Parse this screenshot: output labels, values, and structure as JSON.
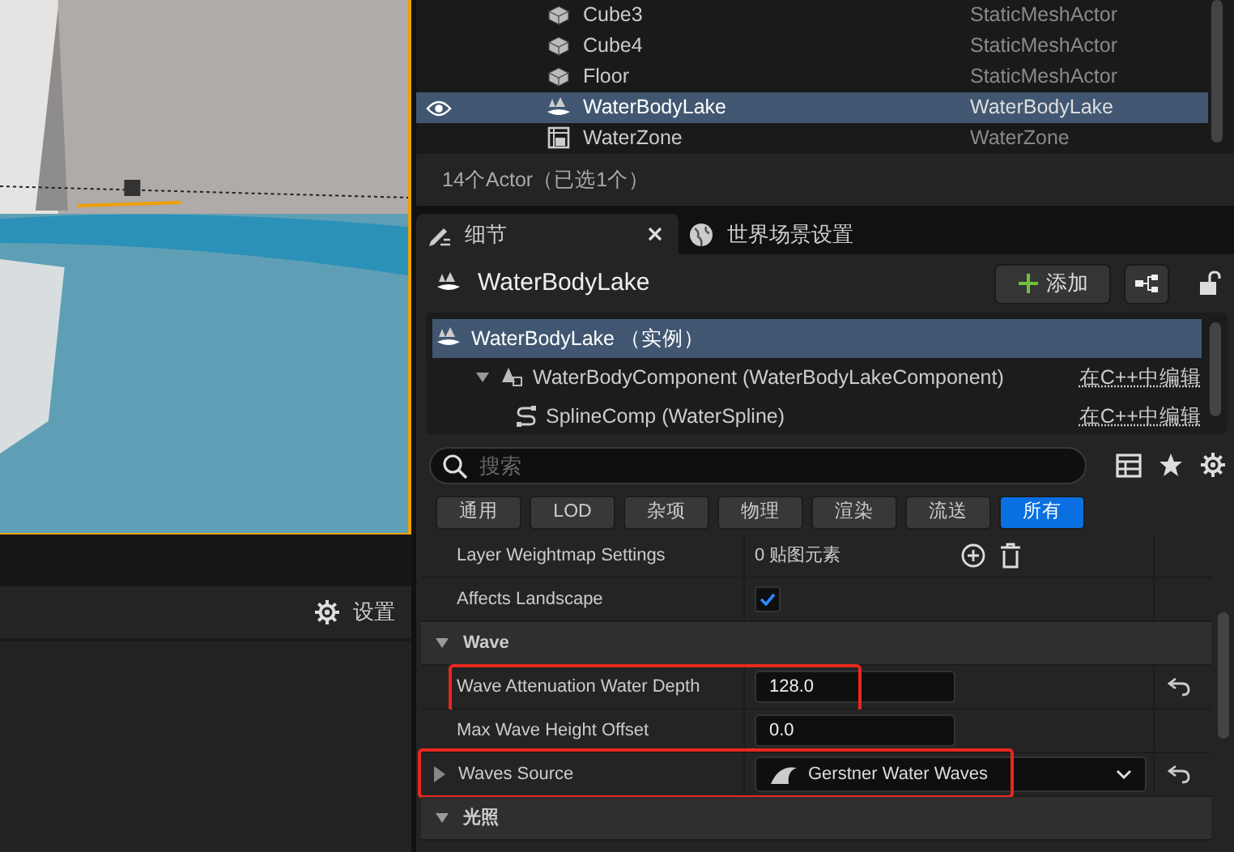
{
  "viewport": {
    "settings_label": "设置"
  },
  "outliner": {
    "rows": [
      {
        "label": "Cube3",
        "type": "StaticMeshActor",
        "kind": "mesh",
        "selected": false,
        "visible": false
      },
      {
        "label": "Cube4",
        "type": "StaticMeshActor",
        "kind": "mesh",
        "selected": false,
        "visible": false
      },
      {
        "label": "Floor",
        "type": "StaticMeshActor",
        "kind": "mesh",
        "selected": false,
        "visible": false
      },
      {
        "label": "WaterBodyLake",
        "type": "WaterBodyLake",
        "kind": "water",
        "selected": true,
        "visible": true
      },
      {
        "label": "WaterZone",
        "type": "WaterZone",
        "kind": "zone",
        "selected": false,
        "visible": false
      }
    ],
    "footer": "14个Actor（已选1个）"
  },
  "details": {
    "tabs": [
      {
        "label": "细节",
        "kind": "pencil",
        "selected": true,
        "closable": true
      },
      {
        "label": "世界场景设置",
        "kind": "globe",
        "selected": false,
        "closable": false
      }
    ],
    "title": "WaterBodyLake",
    "add_button": "添加",
    "components": [
      {
        "label": "WaterBodyLake （实例）",
        "kind": "water",
        "selected": true,
        "children": [
          {
            "label": "WaterBodyComponent (WaterBodyLakeComponent)",
            "kind": "component",
            "link": "在C++中编辑",
            "selected": false,
            "expanded": true,
            "children": [
              {
                "label": "SplineComp (WaterSpline)",
                "kind": "spline",
                "link": "在C++中编辑",
                "selected": false
              }
            ]
          }
        ]
      }
    ],
    "search": {
      "placeholder": "搜索"
    },
    "filters": [
      {
        "label": "通用",
        "selected": false
      },
      {
        "label": "LOD",
        "selected": false
      },
      {
        "label": "杂项",
        "selected": false
      },
      {
        "label": "物理",
        "selected": false
      },
      {
        "label": "渲染",
        "selected": false
      },
      {
        "label": "流送",
        "selected": false
      },
      {
        "label": "所有",
        "selected": true
      }
    ],
    "properties": [
      {
        "kind": "array",
        "label": "Layer Weightmap Settings",
        "value": "0 贴图元素"
      },
      {
        "kind": "checkbox",
        "label": "Affects Landscape",
        "checked": true
      },
      {
        "kind": "category",
        "label": "Wave",
        "expanded": true
      },
      {
        "kind": "number",
        "label": "Wave Attenuation Water Depth",
        "value": "128.0",
        "reset": true,
        "highlighted": true
      },
      {
        "kind": "number",
        "label": "Max Wave Height Offset",
        "value": "0.0",
        "reset": false,
        "highlighted": false
      },
      {
        "kind": "asset",
        "label": "Waves Source",
        "value": "Gerstner Water Waves",
        "reset": true,
        "highlighted": true
      },
      {
        "kind": "category",
        "label": "光照",
        "expanded": true
      }
    ]
  }
}
